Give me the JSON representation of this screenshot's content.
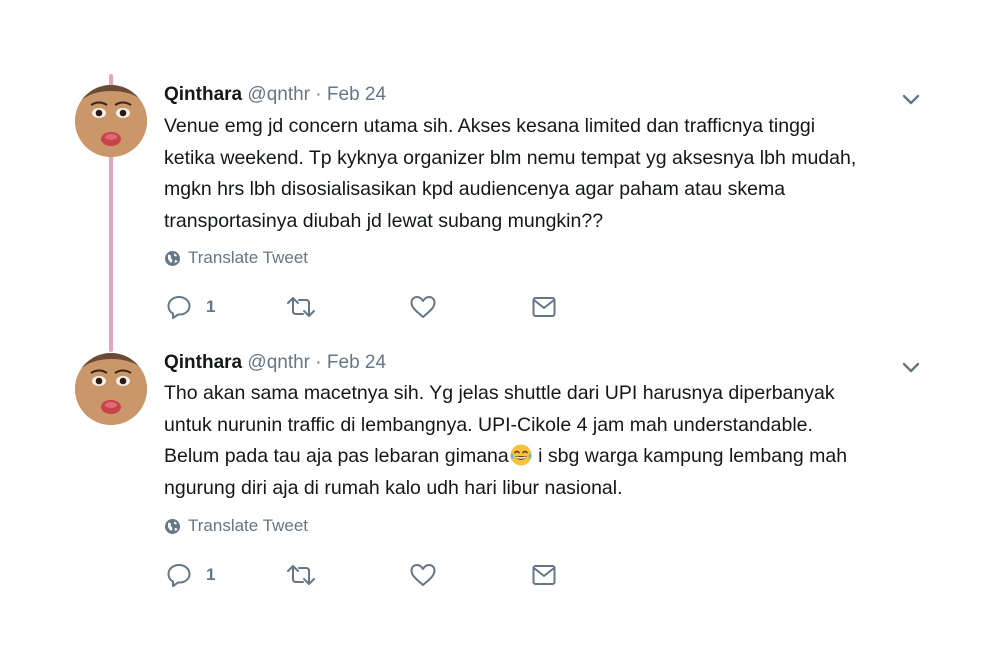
{
  "tweets": [
    {
      "name": "Qinthara",
      "handle": "@qnthr",
      "separator": "·",
      "date": "Feb 24",
      "lines": [
        "Venue emg jd concern utama sih. Akses kesana limited dan trafficnya tinggi",
        "ketika weekend. Tp kyknya organizer blm nemu tempat yg aksesnya lbh mudah,",
        "mgkn hrs lbh disosialisasikan kpd audiencenya agar paham atau skema",
        "transportasinya diubah jd lewat subang mungkin??"
      ],
      "translate_label": "Translate Tweet",
      "reply_count": "1"
    },
    {
      "name": "Qinthara",
      "handle": "@qnthr",
      "separator": "·",
      "date": "Feb 24",
      "lines": [
        "Tho akan sama macetnya sih. Yg jelas shuttle dari UPI harusnya diperbanyak",
        "untuk nurunin traffic di lembangnya. UPI-Cikole 4 jam mah understandable.",
        "Belum pada tau aja pas lebaran gimana",
        " i sbg warga kampung lembang mah",
        "ngurung diri aja di rumah kalo udh hari libur nasional."
      ],
      "translate_label": "Translate Tweet",
      "reply_count": "1"
    }
  ],
  "icons": {
    "more": "chevron-down-icon",
    "globe": "globe-icon",
    "reply": "reply-icon",
    "retweet": "retweet-icon",
    "like": "heart-icon",
    "dm": "envelope-icon",
    "emoji": "tears-of-joy-emoji"
  },
  "colors": {
    "text": "#14171a",
    "secondary": "#657786",
    "thread_line": "#e0a7c3",
    "emoji": "#f7c33a"
  }
}
